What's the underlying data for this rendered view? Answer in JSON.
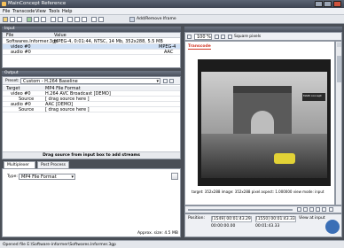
{
  "window": {
    "title": "MainConcept Reference"
  },
  "menu": {
    "items": [
      "File",
      "Transcode",
      "View",
      "Tools",
      "Help"
    ]
  },
  "toolbar": {
    "addremove_label": "Add/Remove Iframe"
  },
  "input_panel": {
    "header": "Input",
    "columns": [
      "File",
      "Value"
    ],
    "rows": [
      {
        "name": "Softwares.Informer.3gp",
        "value": "MPEG-4, 0:01:44, NTSC, 14 Mb, 352x288, 5.5 MB"
      },
      {
        "name": "video #0",
        "value": "",
        "value2": "MPEG-4"
      },
      {
        "name": "audio #0",
        "value": "",
        "value2": "AAC"
      }
    ]
  },
  "output_panel": {
    "header": "Output",
    "preset_label": "Preset:",
    "preset_value": "Custom - H.264 Baseline",
    "columns": [
      "Target",
      "MP4 File Format"
    ],
    "rows": [
      {
        "name": "video #0",
        "value": "H.264 AVC Broadcast [DEMO]"
      },
      {
        "name": "Source",
        "value": "[ drag source here ]"
      },
      {
        "name": "audio #0",
        "value": "AAC [DEMO]"
      },
      {
        "name": "Source",
        "value": "[ drag source here ]"
      }
    ],
    "drag_hint": "Drag source from input box to add streams"
  },
  "settings_panel": {
    "tabs": [
      "Multiplexer",
      "Post Process"
    ],
    "type_label": "Type:",
    "type_value": "MP4 File Format",
    "approx_size": "Approx. size: 4.5 MB"
  },
  "preview": {
    "zoom": "100 %",
    "aspect_option": "Square pixels",
    "stamp": "Transcode",
    "logo_text": "MAIN concept",
    "info_line": "target: 352x288 image: 352x288 pixel aspect: 1.000000 view mode: input",
    "position_label": "Position:",
    "pos_frame": "[1549] 00:01:43.29",
    "pos_frame2": "[1550] 00:01:43.33",
    "view_label": "View at input",
    "time": "00:00:00.00",
    "time2": "00:01:43.33"
  },
  "status": {
    "text": "Opened file E:\\Software-informer\\Softwares.Informer.3gp"
  },
  "colors": {
    "panel_header": "#5a6170",
    "selection": "#cfe0f5",
    "stamp": "#d23a2a"
  }
}
